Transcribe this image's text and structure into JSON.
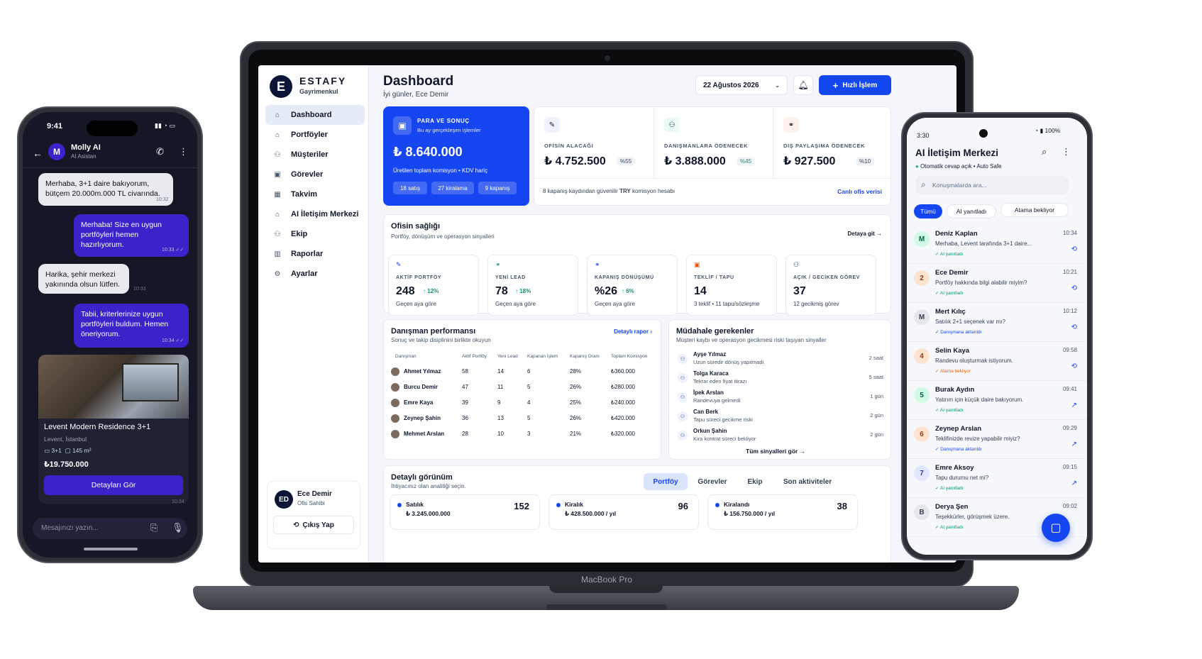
{
  "laptop": {
    "brand": "MacBook Pro",
    "app": {
      "logo_letter": "E",
      "logo_title": "ESTAFY",
      "logo_sub": "Gayrimenkul",
      "nav": [
        {
          "label": "Dashboard",
          "icon": "⌂"
        },
        {
          "label": "Portföyler",
          "icon": "⌂"
        },
        {
          "label": "Müşteriler",
          "icon": "⚇"
        },
        {
          "label": "Görevler",
          "icon": "▣"
        },
        {
          "label": "Takvim",
          "icon": "▦"
        },
        {
          "label": "AI İletişim Merkezi",
          "icon": "⌂"
        },
        {
          "label": "Ekip",
          "icon": "⚇"
        },
        {
          "label": "Raporlar",
          "icon": "▥"
        },
        {
          "label": "Ayarlar",
          "icon": "⚙"
        }
      ],
      "user": {
        "initials": "ED",
        "name": "Ece Demir",
        "role": "Ofis Sahibi",
        "logout": "Çıkış Yap"
      },
      "header": {
        "title": "Dashboard",
        "greeting": "İyi günler, Ece Demir",
        "date": "22 Ağustos 2026",
        "quick": "Hızlı İşlem"
      },
      "hero": {
        "label": "PARA VE SONUÇ",
        "sub": "Bu ay gerçekleşen işlemler",
        "value": "₺ 8.640.000",
        "note": "Üretilen toplam komisyon • KDV hariç",
        "pills": [
          "18 satış",
          "27 kiralama",
          "9 kapanış"
        ]
      },
      "kpis": [
        {
          "label": "OFİSİN ALACAĞI",
          "value": "₺ 4.752.500",
          "pct": "%55",
          "icon": "✎",
          "icon_bg": "#eef2ff",
          "pct_color": "#334155"
        },
        {
          "label": "DANIŞMANLARA ÖDENECEK",
          "value": "₺ 3.888.000",
          "pct": "%45",
          "icon": "⚇",
          "icon_bg": "#ecfdf5",
          "pct_color": "#059669"
        },
        {
          "label": "DIŞ PAYLAŞIMA ÖDENECEK",
          "value": "₺ 927.500",
          "pct": "%10",
          "icon": "⚭",
          "icon_bg": "#fff1ec",
          "pct_color": "#334155"
        }
      ],
      "kpi_footer": {
        "note_pre": "8 kapanış kaydından güvenilir ",
        "note_bold": "TRY",
        "note_post": " komisyon hesabı",
        "link": "Canlı ofis verisi"
      },
      "health": {
        "title": "Ofisin sağlığı",
        "sub": "Portföy, dönüşüm ve operasyon sinyalleri",
        "link": "Detaya git →",
        "cards": [
          {
            "label": "AKTİF PORTFÖY",
            "value": "248",
            "up": "↑ 12%",
            "cap": "Geçen aya göre",
            "icon": "✎",
            "icon_color": "#1645f2"
          },
          {
            "label": "YENİ LEAD",
            "value": "78",
            "up": "↑ 18%",
            "cap": "Geçen aya göre",
            "icon": "⚭",
            "icon_color": "#059669"
          },
          {
            "label": "KAPANIŞ DÖNÜŞÜMÜ",
            "value": "%26",
            "up": "↑ 6%",
            "cap": "Geçen aya göre",
            "icon": "⚭",
            "icon_color": "#1645f2"
          },
          {
            "label": "TEKLİF / TAPU",
            "value": "14",
            "up": "",
            "cap": "3 teklif • 11 tapu/sözleşme",
            "icon": "▣",
            "icon_color": "#ea580c"
          },
          {
            "label": "AÇIK / GECİKEN GÖREV",
            "value": "37",
            "up": "",
            "cap": "12 gecikmiş görev",
            "icon": "⚇",
            "icon_color": "#1e3a8a"
          }
        ]
      },
      "performance": {
        "title": "Danışman performansı",
        "sub": "Sonuç ve takip disiplinini birlikte okuyun",
        "link": "Detaylı rapor ›",
        "headers": [
          "Danışman",
          "Aktif Portföy",
          "Yeni Lead",
          "Kapanan İşlem",
          "Kapanış Oranı",
          "Toplam Komisyon"
        ],
        "rows": [
          [
            "Ahmet Yılmaz",
            "58",
            "14",
            "6",
            "28%",
            "₺360.000"
          ],
          [
            "Burcu Demir",
            "47",
            "11",
            "5",
            "26%",
            "₺280.000"
          ],
          [
            "Emre Kaya",
            "39",
            "9",
            "4",
            "25%",
            "₺240.000"
          ],
          [
            "Zeynep Şahin",
            "36",
            "13",
            "5",
            "26%",
            "₺420.000"
          ],
          [
            "Mehmet Arslan",
            "28",
            "10",
            "3",
            "21%",
            "₺320.000"
          ]
        ]
      },
      "intervention": {
        "title": "Müdahale gerekenler",
        "sub": "Müşteri kaybı ve operasyon gecikmesi riski taşıyan sinyaller",
        "link": "Tüm sinyalleri gör →",
        "items": [
          {
            "name": "Ayşe Yılmaz",
            "desc": "Uzun süredir dönüş yapılmadı",
            "time": "2 saat"
          },
          {
            "name": "Tolga Karaca",
            "desc": "Tekrar eden fiyat itirazı",
            "time": "5 saat"
          },
          {
            "name": "İpek Arslan",
            "desc": "Randevuya gelmedi",
            "time": "1 gün"
          },
          {
            "name": "Can Berk",
            "desc": "Tapu süreci gecikme riski",
            "time": "2 gün"
          },
          {
            "name": "Orkun Şahin",
            "desc": "Kira kontrat süreci bekliyor",
            "time": "2 gün"
          }
        ]
      },
      "detail": {
        "title": "Detaylı görünüm",
        "sub": "İhtiyacınız olan analitiği seçin.",
        "tabs": [
          "Portföy",
          "Görevler",
          "Ekip",
          "Son aktiviteler"
        ],
        "stats": [
          {
            "label": "Satılık",
            "value": "₺ 3.245.000.000",
            "count": "152",
            "color": "#1645f2"
          },
          {
            "label": "Kiralık",
            "value": "₺ 428.500.000 / yıl",
            "count": "96",
            "color": "#1645f2"
          },
          {
            "label": "Kiralandı",
            "value": "₺ 156.750.000 / yıl",
            "count": "38",
            "color": "#1645f2"
          }
        ]
      }
    }
  },
  "phone_left": {
    "time": "9:41",
    "contact": "Molly AI",
    "contact_role": "AI Asistan",
    "avatar": "M",
    "messages": [
      {
        "side": "l",
        "text": "Merhaba, 3+1 daire bakıyorum, bütçem 20.000m.000 TL civarında.",
        "time": "10:32"
      },
      {
        "side": "r",
        "text": "Merhaba! Size en uygun portföyleri hemen hazırlıyorum.",
        "time": "10:33 ✓✓"
      },
      {
        "side": "l",
        "text": "Harika, şehir merkezi yakınında olsun lütfen.",
        "time": "10:33"
      },
      {
        "side": "r",
        "text": "Tabii, kriterlerinize uygun portföyleri buldum. Hemen öneriyorum.",
        "time": "10:34 ✓✓"
      }
    ],
    "listing": {
      "title": "Levent Modern Residence 3+1",
      "location": "Levent, İstanbul",
      "rooms": "3+1",
      "area": "145 m²",
      "price": "₺19.750.000",
      "button": "Detayları Gör",
      "time": "10:34"
    },
    "input_placeholder": "Mesajınızı yazın..."
  },
  "phone_right": {
    "time": "3:30",
    "battery": "100%",
    "title": "AI İletişim Merkezi",
    "status": "Otomatik cevap açık • Auto Safe",
    "search_placeholder": "Konuşmalarda ara...",
    "filters": [
      "Tümü",
      "AI yanıtladı",
      "Atama bekliyor"
    ],
    "conversations": [
      {
        "initial": "M",
        "name": "Deniz Kaplan",
        "msg": "Merhaba, Levent tarafında 3+1 daire...",
        "status": "AI yanıtladı",
        "status_color": "#059669",
        "time": "10:34",
        "bg": "#d1fae5",
        "fg": "#065f46",
        "sym": "⟲"
      },
      {
        "initial": "2",
        "name": "Ece Demir",
        "msg": "Portföy hakkında bilgi alabilir miyim?",
        "status": "AI yanıtladı",
        "status_color": "#059669",
        "time": "10:21",
        "bg": "#fde4d0",
        "fg": "#9a3412",
        "sym": "⟲"
      },
      {
        "initial": "M",
        "name": "Mert Kılıç",
        "msg": "Satılık 2+1 seçenek var mı?",
        "status": "Danışmana aktarıldı",
        "status_color": "#1645f2",
        "time": "10:12",
        "bg": "#e5e7eb",
        "fg": "#374151",
        "sym": "⟲"
      },
      {
        "initial": "4",
        "name": "Selin Kaya",
        "msg": "Randevu oluşturmak istiyorum.",
        "status": "Atama bekliyor",
        "status_color": "#ea580c",
        "time": "09:58",
        "bg": "#fde4d0",
        "fg": "#9a3412",
        "sym": "⟲"
      },
      {
        "initial": "5",
        "name": "Burak Aydın",
        "msg": "Yatırım için küçük daire bakıyorum.",
        "status": "AI yanıtladı",
        "status_color": "#059669",
        "time": "09:41",
        "bg": "#d1fae5",
        "fg": "#065f46",
        "sym": "↗"
      },
      {
        "initial": "6",
        "name": "Zeynep Arslan",
        "msg": "Teklifinizde revize yapabilir miyiz?",
        "status": "Danışmana aktarıldı",
        "status_color": "#1645f2",
        "time": "09:29",
        "bg": "#fde4d0",
        "fg": "#9a3412",
        "sym": "↗"
      },
      {
        "initial": "7",
        "name": "Emre Aksoy",
        "msg": "Tapu durumu net mi?",
        "status": "AI yanıtladı",
        "status_color": "#059669",
        "time": "09:15",
        "bg": "#e0e7ff",
        "fg": "#3730a3",
        "sym": "↗"
      },
      {
        "initial": "B",
        "name": "Derya Şen",
        "msg": "Teşekkürler, görüşmek üzere.",
        "status": "AI yanıtladı",
        "status_color": "#059669",
        "time": "09:02",
        "bg": "#e5e7eb",
        "fg": "#374151",
        "sym": ""
      }
    ]
  }
}
